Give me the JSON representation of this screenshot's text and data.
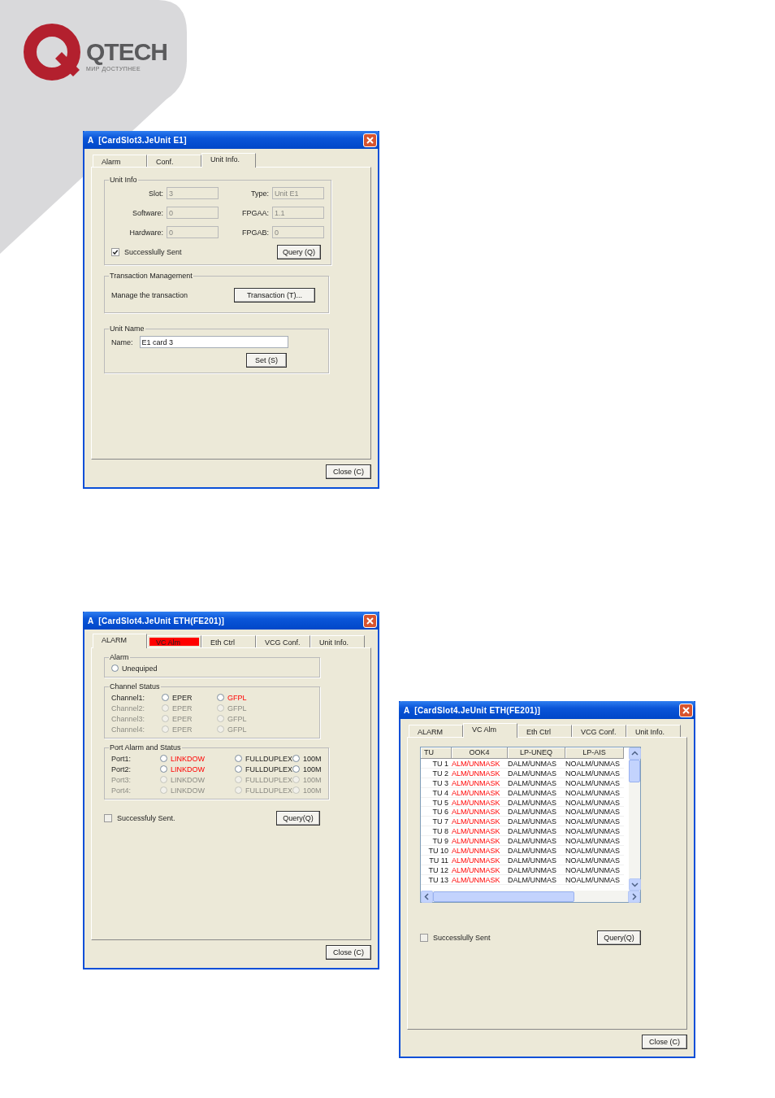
{
  "logo": {
    "name": "QTECH",
    "tagline": "МИР ДОСТУПНЕЕ"
  },
  "dialogs": [
    {
      "kind": "unit_info",
      "title": "A  [CardSlot3.JeUnit E1]",
      "tabs": [
        {
          "label": "Alarm",
          "selected": false,
          "alert": false
        },
        {
          "label": "Conf.",
          "selected": false,
          "alert": false
        },
        {
          "label": "Unit Info.",
          "selected": true,
          "alert": false
        }
      ],
      "groups": [
        {
          "kind": "fields",
          "title": "Unit Info",
          "fields": [
            {
              "label": "Slot:",
              "value": "3",
              "disabled": true
            },
            {
              "label": "Type:",
              "value": "Unit E1",
              "disabled": true
            },
            {
              "label": "Software:",
              "value": "0",
              "disabled": true
            },
            {
              "label": "FPGAA:",
              "value": "1.1",
              "disabled": true
            },
            {
              "label": "Hardware:",
              "value": "0",
              "disabled": true
            },
            {
              "label": "FPGAB:",
              "value": "0",
              "disabled": true
            }
          ],
          "checkbox": {
            "label": "Successlully Sent",
            "checked": true
          },
          "button": "Query (Q)"
        },
        {
          "kind": "action",
          "title": "Transaction Management",
          "text": "Manage the transaction",
          "button": "Transaction (T)..."
        },
        {
          "kind": "name",
          "title": "Unit Name",
          "label": "Name:",
          "value": "E1 card 3",
          "disabled": false,
          "button": "Set (S)"
        }
      ],
      "close": "Close (C)"
    },
    {
      "kind": "alarm",
      "title": "A  [CardSlot4.JeUnit ETH(FE201)]",
      "tabs": [
        {
          "label": "ALARM",
          "selected": true,
          "alert": false
        },
        {
          "label": "VC Alm",
          "selected": false,
          "alert": true
        },
        {
          "label": "Eth Ctrl",
          "selected": false,
          "alert": false
        },
        {
          "label": "VCG Conf.",
          "selected": false,
          "alert": false
        },
        {
          "label": "Unit Info.",
          "selected": false,
          "alert": false
        }
      ],
      "groups": [
        {
          "kind": "radios",
          "title": "Alarm",
          "rows": [
            {
              "disabled": false,
              "options": [
                {
                  "label": "Unequiped",
                  "alarm": false,
                  "selected": false
                }
              ]
            }
          ]
        },
        {
          "kind": "radios",
          "title": "Channel Status",
          "rows": [
            {
              "label": "Channel1:",
              "disabled": false,
              "options": [
                {
                  "label": "EPER",
                  "alarm": false,
                  "selected": false
                },
                {
                  "label": "GFPL",
                  "alarm": true,
                  "selected": false
                }
              ]
            },
            {
              "label": "Channel2:",
              "disabled": true,
              "options": [
                {
                  "label": "EPER",
                  "alarm": false,
                  "selected": false
                },
                {
                  "label": "GFPL",
                  "alarm": false,
                  "selected": false
                }
              ]
            },
            {
              "label": "Channel3:",
              "disabled": true,
              "options": [
                {
                  "label": "EPER",
                  "alarm": false,
                  "selected": false
                },
                {
                  "label": "GFPL",
                  "alarm": false,
                  "selected": false
                }
              ]
            },
            {
              "label": "Channel4:",
              "disabled": true,
              "options": [
                {
                  "label": "EPER",
                  "alarm": false,
                  "selected": false
                },
                {
                  "label": "GFPL",
                  "alarm": false,
                  "selected": false
                }
              ]
            }
          ]
        },
        {
          "kind": "radios",
          "title": "Port Alarm and Status",
          "rows": [
            {
              "label": "Port1:",
              "disabled": false,
              "options": [
                {
                  "label": "LINKDOW",
                  "alarm": true,
                  "selected": false
                },
                {
                  "label": "FULLDUPLEX",
                  "alarm": false,
                  "selected": false
                },
                {
                  "label": "100M",
                  "alarm": false,
                  "selected": false
                }
              ]
            },
            {
              "label": "Port2:",
              "disabled": false,
              "options": [
                {
                  "label": "LINKDOW",
                  "alarm": true,
                  "selected": false
                },
                {
                  "label": "FULLDUPLEX",
                  "alarm": false,
                  "selected": false
                },
                {
                  "label": "100M",
                  "alarm": false,
                  "selected": false
                }
              ]
            },
            {
              "label": "Port3:",
              "disabled": true,
              "options": [
                {
                  "label": "LINKDOW",
                  "alarm": false,
                  "selected": false
                },
                {
                  "label": "FULLDUPLEX",
                  "alarm": false,
                  "selected": false
                },
                {
                  "label": "100M",
                  "alarm": false,
                  "selected": false
                }
              ]
            },
            {
              "label": "Port4:",
              "disabled": true,
              "options": [
                {
                  "label": "LINKDOW",
                  "alarm": false,
                  "selected": false
                },
                {
                  "label": "FULLDUPLEX",
                  "alarm": false,
                  "selected": false
                },
                {
                  "label": "100M",
                  "alarm": false,
                  "selected": false
                }
              ]
            }
          ]
        }
      ],
      "checkbox": {
        "label": "Successfuly Sent.",
        "checked": false
      },
      "button": "Query(Q)",
      "close": "Close (C)"
    },
    {
      "kind": "vc_alarm",
      "title": "A  [CardSlot4.JeUnit ETH(FE201)]",
      "tabs": [
        {
          "label": "ALARM",
          "selected": false,
          "alert": false
        },
        {
          "label": "VC Alm",
          "selected": true,
          "alert": false
        },
        {
          "label": "Eth Ctrl",
          "selected": false,
          "alert": false
        },
        {
          "label": "VCG Conf.",
          "selected": false,
          "alert": false
        },
        {
          "label": "Unit Info.",
          "selected": false,
          "alert": false
        }
      ],
      "table": {
        "columns": [
          "TU",
          "OOK4",
          "LP-UNEQ",
          "LP-AIS"
        ],
        "rows": [
          {
            "cells": [
              {
                "text": "TU 1",
                "alarm": false
              },
              {
                "text": "ALM/UNMASK",
                "alarm": true
              },
              {
                "text": "DALM/UNMAS",
                "alarm": false
              },
              {
                "text": "NOALM/UNMAS",
                "alarm": false
              }
            ]
          },
          {
            "cells": [
              {
                "text": "TU 2",
                "alarm": false
              },
              {
                "text": "ALM/UNMASK",
                "alarm": true
              },
              {
                "text": "DALM/UNMAS",
                "alarm": false
              },
              {
                "text": "NOALM/UNMAS",
                "alarm": false
              }
            ]
          },
          {
            "cells": [
              {
                "text": "TU 3",
                "alarm": false
              },
              {
                "text": "ALM/UNMASK",
                "alarm": true
              },
              {
                "text": "DALM/UNMAS",
                "alarm": false
              },
              {
                "text": "NOALM/UNMAS",
                "alarm": false
              }
            ]
          },
          {
            "cells": [
              {
                "text": "TU 4",
                "alarm": false
              },
              {
                "text": "ALM/UNMASK",
                "alarm": true
              },
              {
                "text": "DALM/UNMAS",
                "alarm": false
              },
              {
                "text": "NOALM/UNMAS",
                "alarm": false
              }
            ]
          },
          {
            "cells": [
              {
                "text": "TU 5",
                "alarm": false
              },
              {
                "text": "ALM/UNMASK",
                "alarm": true
              },
              {
                "text": "DALM/UNMAS",
                "alarm": false
              },
              {
                "text": "NOALM/UNMAS",
                "alarm": false
              }
            ]
          },
          {
            "cells": [
              {
                "text": "TU 6",
                "alarm": false
              },
              {
                "text": "ALM/UNMASK",
                "alarm": true
              },
              {
                "text": "DALM/UNMAS",
                "alarm": false
              },
              {
                "text": "NOALM/UNMAS",
                "alarm": false
              }
            ]
          },
          {
            "cells": [
              {
                "text": "TU 7",
                "alarm": false
              },
              {
                "text": "ALM/UNMASK",
                "alarm": true
              },
              {
                "text": "DALM/UNMAS",
                "alarm": false
              },
              {
                "text": "NOALM/UNMAS",
                "alarm": false
              }
            ]
          },
          {
            "cells": [
              {
                "text": "TU 8",
                "alarm": false
              },
              {
                "text": "ALM/UNMASK",
                "alarm": true
              },
              {
                "text": "DALM/UNMAS",
                "alarm": false
              },
              {
                "text": "NOALM/UNMAS",
                "alarm": false
              }
            ]
          },
          {
            "cells": [
              {
                "text": "TU 9",
                "alarm": false
              },
              {
                "text": "ALM/UNMASK",
                "alarm": true
              },
              {
                "text": "DALM/UNMAS",
                "alarm": false
              },
              {
                "text": "NOALM/UNMAS",
                "alarm": false
              }
            ]
          },
          {
            "cells": [
              {
                "text": "TU 10",
                "alarm": false
              },
              {
                "text": "ALM/UNMASK",
                "alarm": true
              },
              {
                "text": "DALM/UNMAS",
                "alarm": false
              },
              {
                "text": "NOALM/UNMAS",
                "alarm": false
              }
            ]
          },
          {
            "cells": [
              {
                "text": "TU 11",
                "alarm": false
              },
              {
                "text": "ALM/UNMASK",
                "alarm": true
              },
              {
                "text": "DALM/UNMAS",
                "alarm": false
              },
              {
                "text": "NOALM/UNMAS",
                "alarm": false
              }
            ]
          },
          {
            "cells": [
              {
                "text": "TU 12",
                "alarm": false
              },
              {
                "text": "ALM/UNMASK",
                "alarm": true
              },
              {
                "text": "DALM/UNMAS",
                "alarm": false
              },
              {
                "text": "NOALM/UNMAS",
                "alarm": false
              }
            ]
          },
          {
            "cells": [
              {
                "text": "TU 13",
                "alarm": false
              },
              {
                "text": "ALM/UNMASK",
                "alarm": true
              },
              {
                "text": "DALM/UNMAS",
                "alarm": false
              },
              {
                "text": "NOALM/UNMAS",
                "alarm": false
              }
            ]
          }
        ]
      },
      "checkbox": {
        "label": "Successlully Sent",
        "checked": false
      },
      "button": "Query(Q)",
      "close": "Close (C)"
    }
  ]
}
